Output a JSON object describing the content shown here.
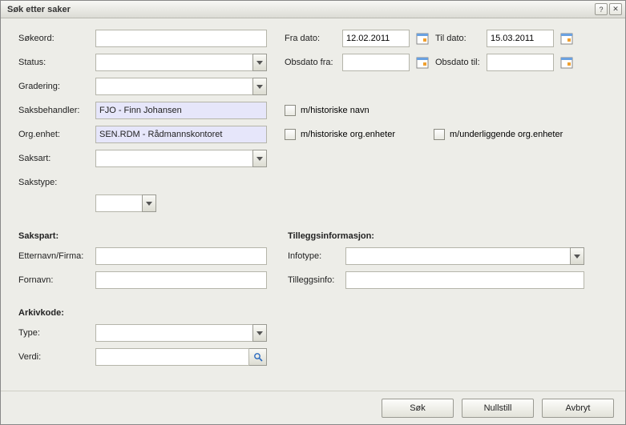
{
  "window": {
    "title": "Søk etter saker"
  },
  "labels": {
    "sokeord": "Søkeord:",
    "status": "Status:",
    "gradering": "Gradering:",
    "saksbehandler": "Saksbehandler:",
    "orgenhet": "Org.enhet:",
    "saksart": "Saksart:",
    "sakstype": "Sakstype:",
    "fradato": "Fra dato:",
    "tildato": "Til dato:",
    "obsdatofra": "Obsdato fra:",
    "obsdatotil": "Obsdato til:",
    "mhistnavn": "m/historiske navn",
    "mhistorg": "m/historiske org.enheter",
    "munderorg": "m/underliggende org.enheter",
    "sakspart_h": "Sakspart:",
    "etternavn": "Etternavn/Firma:",
    "fornavn": "Fornavn:",
    "tillegg_h": "Tilleggsinformasjon:",
    "infotype": "Infotype:",
    "tilleggsinfo": "Tilleggsinfo:",
    "arkivkode_h": "Arkivkode:",
    "type": "Type:",
    "verdi": "Verdi:"
  },
  "values": {
    "sokeord": "",
    "status": "",
    "gradering": "",
    "saksbehandler": "FJO - Finn Johansen",
    "orgenhet": "SEN.RDM - Rådmannskontoret",
    "saksart": "",
    "sakstype": "",
    "fradato": "12.02.2011",
    "tildato": "15.03.2011",
    "obsdatofra": "",
    "obsdatotil": "",
    "etternavn": "",
    "fornavn": "",
    "infotype": "",
    "tilleggsinfo": "",
    "type": "",
    "verdi": ""
  },
  "buttons": {
    "sok": "Søk",
    "nullstill": "Nullstill",
    "avbryt": "Avbryt",
    "help": "?",
    "close": "✕"
  }
}
